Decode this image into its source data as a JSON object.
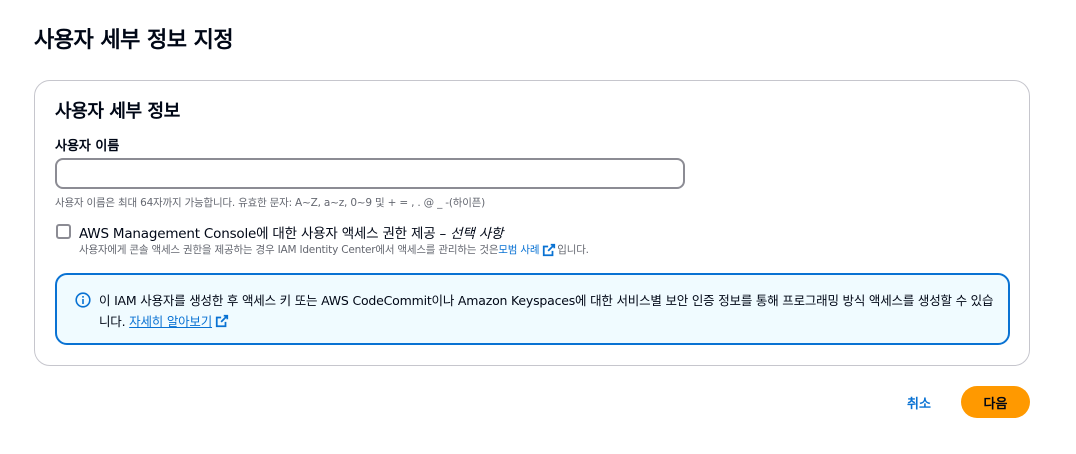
{
  "page": {
    "title": "사용자 세부 정보 지정"
  },
  "user_details": {
    "title": "사용자 세부 정보",
    "username_label": "사용자 이름",
    "username_value": "",
    "username_hint": "사용자 이름은 최대 64자까지 가능합니다. 유효한 문자: A~Z, a~z, 0~9 및 + = , . @ _ -(하이픈)",
    "console_access": {
      "checked": false,
      "label": "AWS Management Console에 대한 사용자 액세스 권한 제공 – ",
      "optional": "선택 사항",
      "desc_before": "사용자에게 콘솔 액세스 권한을 제공하는 경우 IAM Identity Center에서 액세스를 관리하는 것은 ",
      "desc_link": "모범 사례",
      "desc_after": "입니다."
    },
    "info_alert": {
      "text": "이 IAM 사용자를 생성한 후 액세스 키 또는 AWS CodeCommit이나 Amazon Keyspaces에 대한 서비스별 보안 인증 정보를 통해 프로그래밍 방식 액세스를 생성할 수 있습니다. ",
      "link": "자세히 알아보기"
    }
  },
  "actions": {
    "cancel": "취소",
    "next": "다음"
  },
  "colors": {
    "primary": "#ff9900",
    "link": "#0972d3",
    "info_border": "#0972d3",
    "info_bg": "#f0fbff"
  }
}
